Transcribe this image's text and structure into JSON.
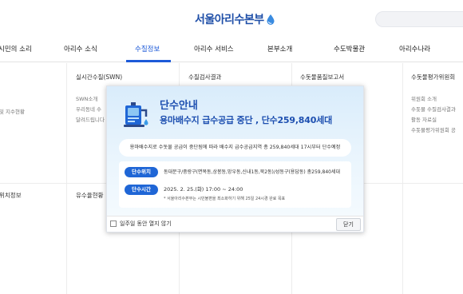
{
  "logo": {
    "text": "서울아리수본부"
  },
  "gnb": {
    "items": [
      "시민의 소리",
      "아리수 소식",
      "수질정보",
      "아리수 서비스",
      "본부소개",
      "수도박물관",
      "아리수나라"
    ],
    "active": "수질정보"
  },
  "mega_menu": {
    "col1_link_partial": "및 지수현황",
    "col1_bottom_partial": "위치정보",
    "col2_bottom": "유수율현황",
    "water_quality": {
      "realtime": {
        "title": "실시간수질(SWN)",
        "items": [
          "SWN소개",
          "우리동네 수",
          "달려드립니다"
        ]
      },
      "inspection": {
        "title": "수질검사결과"
      },
      "report": {
        "title": "수돗물품질보고서"
      },
      "committee": {
        "title": "수돗물평가위원회",
        "items": [
          "위원회 소개",
          "수돗물 수질검사결과",
          "활동 자료실",
          "수돗물평가위원회 공"
        ]
      }
    }
  },
  "popup": {
    "title": "단수안내",
    "subtitle": "용마배수지 급수공급 중단 , 단수259,840세대",
    "summary": "용마배수지로 수돗물 공급이 중단됨에 따라 배수지 급수공급지역 총 259,840세대 17시부터 단수예정",
    "location_tag": "단수위치",
    "location": "동대문구/중랑구(면목동,상봉동,망우동,신내1동,묵2동)/성동구(용답동) 총259,840세대",
    "time_tag": "단수시간",
    "time": "2025. 2. 25.(화) 17:00 ~ 24:00",
    "note": "* 서울아리수본부는 시민불편을 최소화하기 위해 25일 24시경 완료 목표",
    "dont_show": "일주일 동안 열지 않기",
    "close": "닫기"
  },
  "colors": {
    "brand": "#1f4fa8",
    "accent": "#1d5ad8",
    "tag": "#1f66d6"
  }
}
